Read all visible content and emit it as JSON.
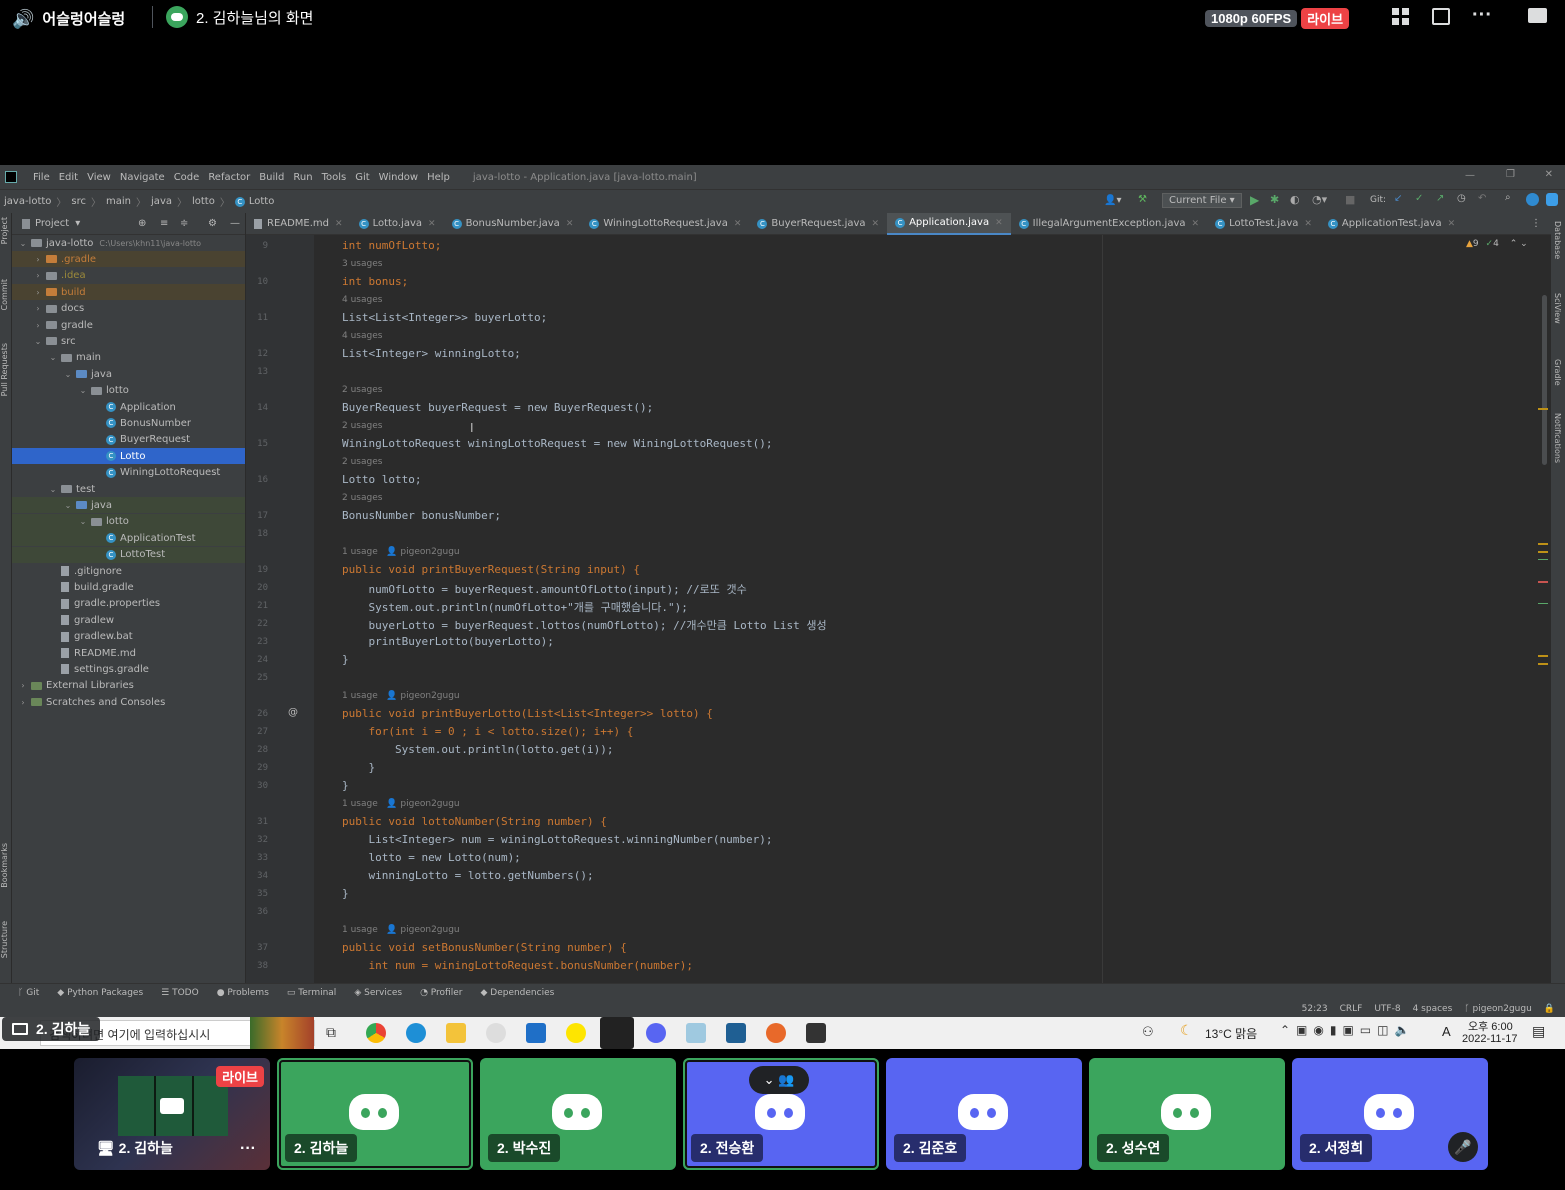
{
  "discord": {
    "channel_name": "어슬렁어슬렁",
    "stream_title": "2. 김하늘님의 화면",
    "quality": "1080p 60FPS",
    "live_label": "라이브"
  },
  "ide": {
    "menu": [
      "File",
      "Edit",
      "View",
      "Navigate",
      "Code",
      "Refactor",
      "Build",
      "Run",
      "Tools",
      "Git",
      "Window",
      "Help"
    ],
    "window_title": "java-lotto - Application.java [java-lotto.main]",
    "breadcrumbs": [
      "java-lotto",
      "src",
      "main",
      "java",
      "lotto",
      "Lotto"
    ],
    "run_config": "Current File",
    "git_label": "Git:",
    "project_label": "Project",
    "tree": [
      {
        "label": "java-lotto",
        "extra": "C:\\Users\\khn11\\java-lotto",
        "depth": 0,
        "kind": "module",
        "open": true,
        "hl": ""
      },
      {
        "label": ".gradle",
        "depth": 1,
        "kind": "folder-or",
        "open": false,
        "hl": "orange"
      },
      {
        "label": ".idea",
        "depth": 1,
        "kind": "folder",
        "open": false,
        "hl": ""
      },
      {
        "label": "build",
        "depth": 1,
        "kind": "folder-or",
        "open": false,
        "hl": "orange"
      },
      {
        "label": "docs",
        "depth": 1,
        "kind": "folder",
        "open": false,
        "hl": ""
      },
      {
        "label": "gradle",
        "depth": 1,
        "kind": "folder",
        "open": false,
        "hl": ""
      },
      {
        "label": "src",
        "depth": 1,
        "kind": "folder",
        "open": true,
        "hl": ""
      },
      {
        "label": "main",
        "depth": 2,
        "kind": "folder",
        "open": true,
        "hl": ""
      },
      {
        "label": "java",
        "depth": 3,
        "kind": "folder-bl",
        "open": true,
        "hl": ""
      },
      {
        "label": "lotto",
        "depth": 4,
        "kind": "folder",
        "open": true,
        "hl": ""
      },
      {
        "label": "Application",
        "depth": 5,
        "kind": "class",
        "hl": ""
      },
      {
        "label": "BonusNumber",
        "depth": 5,
        "kind": "class",
        "hl": ""
      },
      {
        "label": "BuyerRequest",
        "depth": 5,
        "kind": "class",
        "hl": ""
      },
      {
        "label": "Lotto",
        "depth": 5,
        "kind": "class",
        "hl": "sel"
      },
      {
        "label": "WiningLottoRequest",
        "depth": 5,
        "kind": "class",
        "hl": ""
      },
      {
        "label": "test",
        "depth": 2,
        "kind": "folder",
        "open": true,
        "hl": ""
      },
      {
        "label": "java",
        "depth": 3,
        "kind": "folder-bl",
        "open": true,
        "hl": "green"
      },
      {
        "label": "lotto",
        "depth": 4,
        "kind": "folder",
        "open": true,
        "hl": "green"
      },
      {
        "label": "ApplicationTest",
        "depth": 5,
        "kind": "class",
        "hl": "green"
      },
      {
        "label": "LottoTest",
        "depth": 5,
        "kind": "class",
        "hl": "green"
      },
      {
        "label": ".gitignore",
        "depth": 2,
        "kind": "file",
        "hl": ""
      },
      {
        "label": "build.gradle",
        "depth": 2,
        "kind": "file",
        "hl": ""
      },
      {
        "label": "gradle.properties",
        "depth": 2,
        "kind": "file",
        "hl": ""
      },
      {
        "label": "gradlew",
        "depth": 2,
        "kind": "file",
        "hl": ""
      },
      {
        "label": "gradlew.bat",
        "depth": 2,
        "kind": "file",
        "hl": ""
      },
      {
        "label": "README.md",
        "depth": 2,
        "kind": "file",
        "hl": ""
      },
      {
        "label": "settings.gradle",
        "depth": 2,
        "kind": "file",
        "hl": ""
      },
      {
        "label": "External Libraries",
        "depth": 0,
        "kind": "lib",
        "open": false,
        "hl": ""
      },
      {
        "label": "Scratches and Consoles",
        "depth": 0,
        "kind": "lib",
        "open": false,
        "hl": ""
      }
    ],
    "tabs": [
      {
        "label": "README.md",
        "active": false
      },
      {
        "label": "Lotto.java",
        "active": false
      },
      {
        "label": "BonusNumber.java",
        "active": false
      },
      {
        "label": "WiningLottoRequest.java",
        "active": false
      },
      {
        "label": "BuyerRequest.java",
        "active": false
      },
      {
        "label": "Application.java",
        "active": true
      },
      {
        "label": "IllegalArgumentException.java",
        "active": false
      },
      {
        "label": "LottoTest.java",
        "active": false
      },
      {
        "label": "ApplicationTest.java",
        "active": false
      }
    ],
    "inspections": {
      "warnings": "9",
      "ok": "4"
    },
    "code_lines": [
      {
        "t": "code",
        "n": "9",
        "text": "int numOfLotto;"
      },
      {
        "t": "hint",
        "text": "3 usages"
      },
      {
        "t": "code",
        "n": "10",
        "text": "int bonus;"
      },
      {
        "t": "hint",
        "text": "4 usages"
      },
      {
        "t": "code",
        "n": "11",
        "text": "List<List<Integer>> buyerLotto;"
      },
      {
        "t": "hint",
        "text": "4 usages"
      },
      {
        "t": "code",
        "n": "12",
        "text": "List<Integer> winningLotto;"
      },
      {
        "t": "code",
        "n": "13",
        "text": ""
      },
      {
        "t": "hint",
        "text": "2 usages"
      },
      {
        "t": "code",
        "n": "14",
        "text": "BuyerRequest buyerRequest = new BuyerRequest();"
      },
      {
        "t": "hint",
        "text": "2 usages"
      },
      {
        "t": "code",
        "n": "15",
        "text": "WiningLottoRequest winingLottoRequest = new WiningLottoRequest();"
      },
      {
        "t": "hint",
        "text": "2 usages"
      },
      {
        "t": "code",
        "n": "16",
        "text": "Lotto lotto;"
      },
      {
        "t": "hint",
        "text": "2 usages"
      },
      {
        "t": "code",
        "n": "17",
        "text": "BonusNumber bonusNumber;"
      },
      {
        "t": "code",
        "n": "18",
        "text": ""
      },
      {
        "t": "hint",
        "text": "1 usage   👤 pigeon2gugu"
      },
      {
        "t": "code",
        "n": "19",
        "text": "public void printBuyerRequest(String input) {"
      },
      {
        "t": "code",
        "n": "20",
        "text": "    numOfLotto = buyerRequest.amountOfLotto(input); //로또 갯수"
      },
      {
        "t": "code",
        "n": "21",
        "text": "    System.out.println(numOfLotto+\"개를 구매했습니다.\");"
      },
      {
        "t": "code",
        "n": "22",
        "text": "    buyerLotto = buyerRequest.lottos(numOfLotto); //개수만큼 Lotto List 생성"
      },
      {
        "t": "code",
        "n": "23",
        "text": "    printBuyerLotto(buyerLotto);"
      },
      {
        "t": "code",
        "n": "24",
        "text": "}"
      },
      {
        "t": "code",
        "n": "25",
        "text": ""
      },
      {
        "t": "hint",
        "text": "1 usage   👤 pigeon2gugu"
      },
      {
        "t": "code",
        "n": "26",
        "text": "public void printBuyerLotto(List<List<Integer>> lotto) {"
      },
      {
        "t": "code",
        "n": "27",
        "text": "    for(int i = 0 ; i < lotto.size(); i++) {"
      },
      {
        "t": "code",
        "n": "28",
        "text": "        System.out.println(lotto.get(i));"
      },
      {
        "t": "code",
        "n": "29",
        "text": "    }"
      },
      {
        "t": "code",
        "n": "30",
        "text": "}"
      },
      {
        "t": "hint",
        "text": "1 usage   👤 pigeon2gugu"
      },
      {
        "t": "code",
        "n": "31",
        "text": "public void lottoNumber(String number) {"
      },
      {
        "t": "code",
        "n": "32",
        "text": "    List<Integer> num = winingLottoRequest.winningNumber(number);"
      },
      {
        "t": "code",
        "n": "33",
        "text": "    lotto = new Lotto(num);"
      },
      {
        "t": "code",
        "n": "34",
        "text": "    winningLotto = lotto.getNumbers();"
      },
      {
        "t": "code",
        "n": "35",
        "text": "}"
      },
      {
        "t": "code",
        "n": "36",
        "text": ""
      },
      {
        "t": "hint",
        "text": "1 usage   👤 pigeon2gugu"
      },
      {
        "t": "code",
        "n": "37",
        "text": "public void setBonusNumber(String number) {"
      },
      {
        "t": "code",
        "n": "38",
        "text": "    int num = winingLottoRequest.bonusNumber(number);"
      }
    ],
    "bottom_tools": [
      "Git",
      "Python Packages",
      "TODO",
      "Problems",
      "Terminal",
      "Services",
      "Profiler",
      "Dependencies"
    ],
    "status": {
      "position": "52:23",
      "line_sep": "CRLF",
      "encoding": "UTF-8",
      "indent": "4 spaces",
      "branch": "pigeon2gugu"
    },
    "side_left": [
      "Project",
      "Commit",
      "Pull Requests",
      "Bookmarks",
      "Structure"
    ],
    "side_right": [
      "Database",
      "SciView",
      "Gradle",
      "Notifications"
    ]
  },
  "taskbar": {
    "search_placeholder": "검색하려면 여기에 입력하십시시",
    "sharing_label": "2. 김하늘",
    "weather": "13°C  맑음",
    "time": "오후 6:00",
    "date": "2022-11-17"
  },
  "participants": [
    {
      "name": "2. 김하늘",
      "kind": "stream",
      "live": "라이브"
    },
    {
      "name": "2. 김하늘",
      "kind": "green",
      "speaking": true
    },
    {
      "name": "2. 박수진",
      "kind": "green"
    },
    {
      "name": "2. 전승환",
      "kind": "blurple",
      "speaking": true
    },
    {
      "name": "2. 김준호",
      "kind": "blurple"
    },
    {
      "name": "2. 성수연",
      "kind": "green"
    },
    {
      "name": "2. 서정희",
      "kind": "blurple",
      "muted": true
    }
  ],
  "colors": {
    "discord_green": "#3ba55d",
    "discord_blurple": "#5865f2",
    "live_red": "#ed4245",
    "ide_bg": "#2b2b2b",
    "ide_panel": "#3c3f41"
  }
}
